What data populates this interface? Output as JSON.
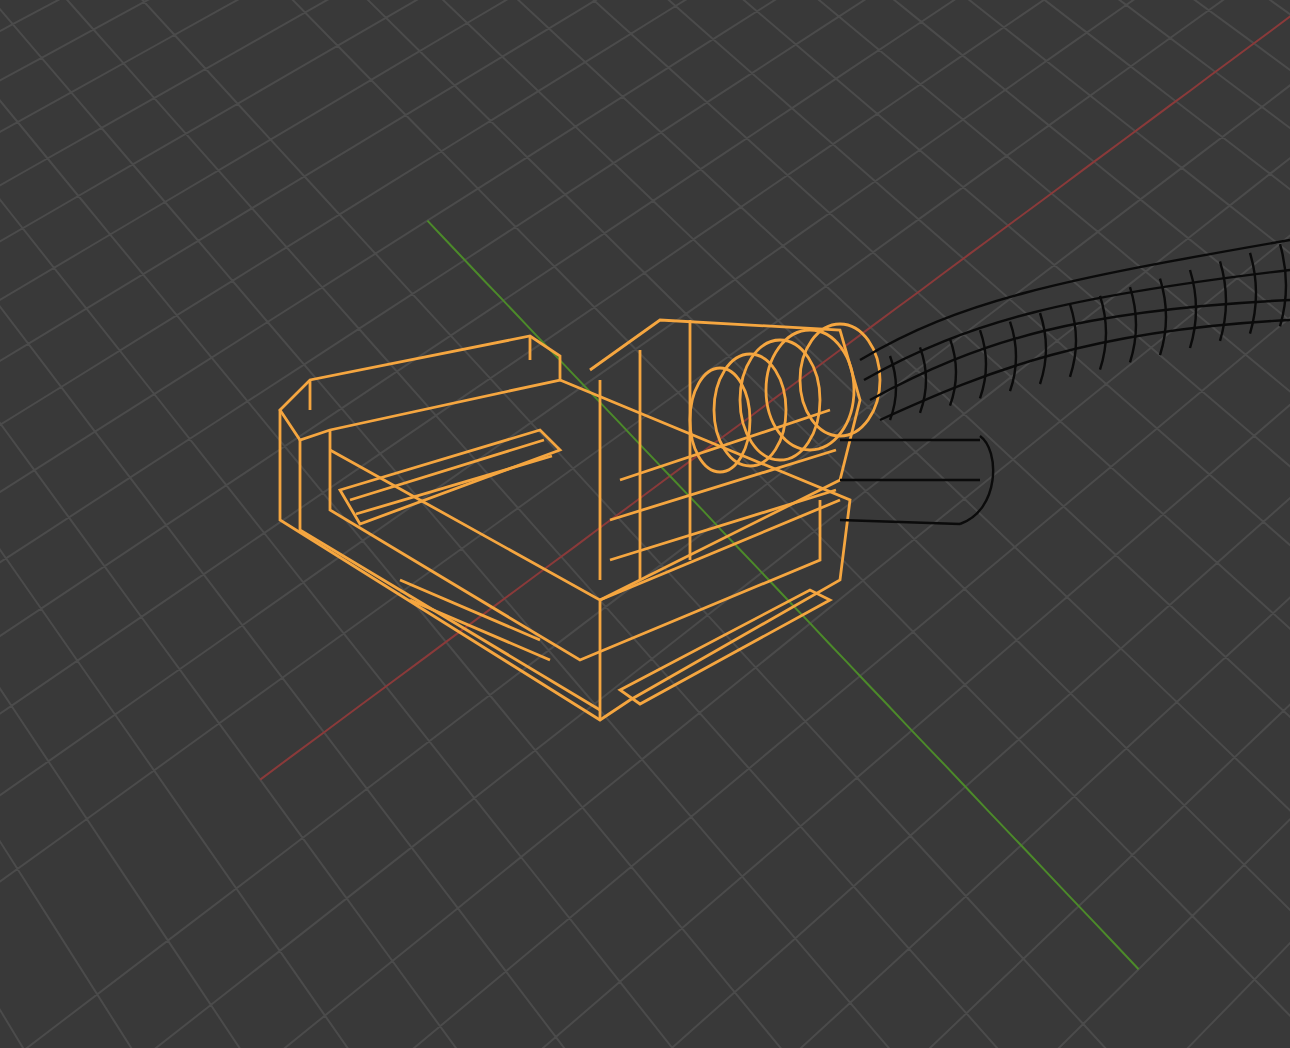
{
  "viewport": {
    "objects": [
      {
        "kind": "connector",
        "selected": true
      },
      {
        "kind": "cable",
        "selected": false
      }
    ]
  }
}
